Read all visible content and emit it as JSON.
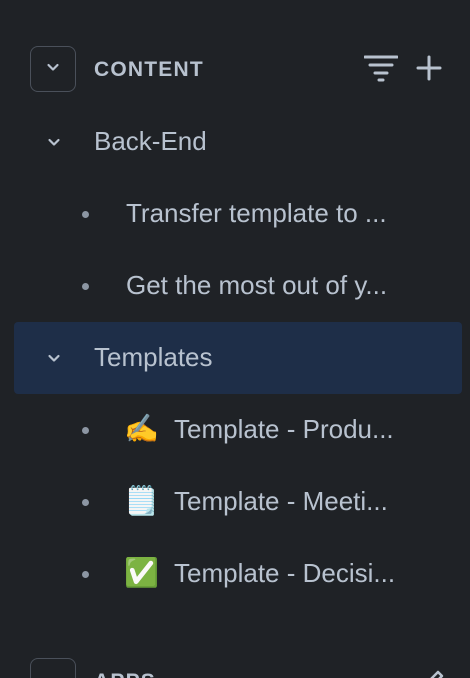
{
  "content_section": {
    "title": "CONTENT",
    "items": [
      {
        "type": "folder",
        "label": "Back-End",
        "expanded": true,
        "selected": false
      },
      {
        "type": "page",
        "label": "Transfer template to ...",
        "emoji": ""
      },
      {
        "type": "page",
        "label": "Get the most out of y...",
        "emoji": ""
      },
      {
        "type": "folder",
        "label": "Templates",
        "expanded": true,
        "selected": true
      },
      {
        "type": "page",
        "label": "Template - Produ...",
        "emoji": "✍️"
      },
      {
        "type": "page",
        "label": "Template - Meeti...",
        "emoji": "🗒️"
      },
      {
        "type": "page",
        "label": "Template - Decisi...",
        "emoji": "✅"
      }
    ]
  },
  "apps_section": {
    "title": "APPS"
  },
  "colors": {
    "background": "#1f2226",
    "text": "#b8c2cf",
    "selected_row": "#1e2e48",
    "border": "#4a505a"
  }
}
